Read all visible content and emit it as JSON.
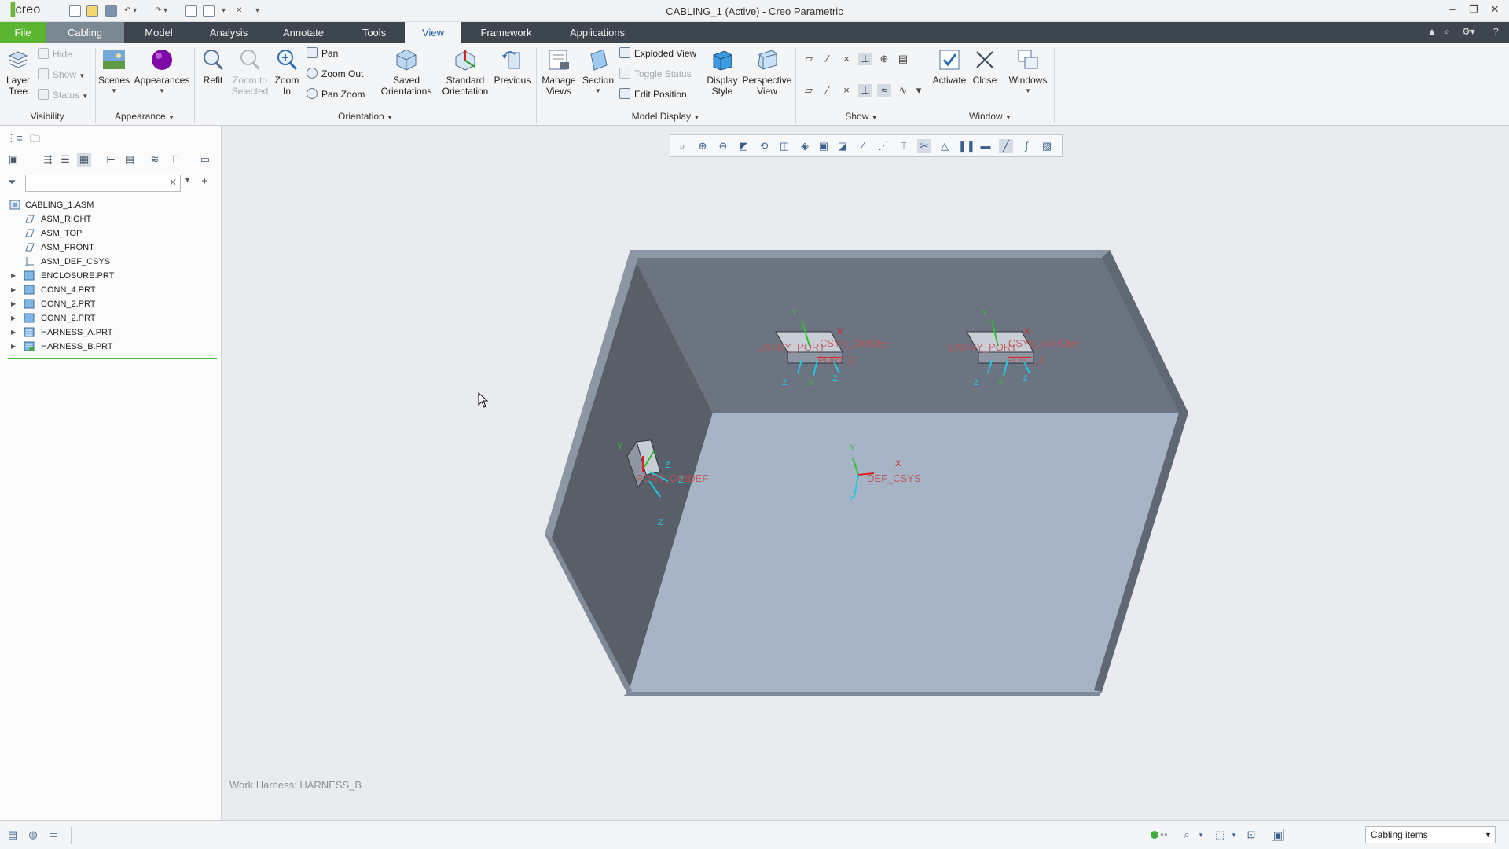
{
  "app": {
    "logo_text": "creo",
    "title": "CABLING_1 (Active) - Creo Parametric"
  },
  "menu": {
    "tabs": [
      "File",
      "Cabling",
      "Model",
      "Analysis",
      "Annotate",
      "Tools",
      "View",
      "Framework",
      "Applications"
    ],
    "active_tab": "View"
  },
  "ribbon": {
    "visibility": {
      "group_label": "Visibility",
      "layer_tree": "Layer\nTree",
      "hide": "Hide",
      "show": "Show",
      "status": "Status"
    },
    "appearance": {
      "group_label": "Appearance",
      "scenes": "Scenes",
      "appearances": "Appearances"
    },
    "orientation": {
      "group_label": "Orientation",
      "refit": "Refit",
      "zoom_to_selected": "Zoom to\nSelected",
      "zoom_in": "Zoom\nIn",
      "pan": "Pan",
      "zoom_out": "Zoom Out",
      "pan_zoom": "Pan Zoom",
      "saved_orientations": "Saved\nOrientations",
      "standard_orientation": "Standard\nOrientation",
      "previous": "Previous"
    },
    "model_display": {
      "group_label": "Model Display",
      "manage_views": "Manage\nViews",
      "section": "Section",
      "exploded_view": "Exploded View",
      "toggle_status": "Toggle Status",
      "edit_position": "Edit Position",
      "display_style": "Display\nStyle",
      "perspective_view": "Perspective\nView"
    },
    "show": {
      "group_label": "Show"
    },
    "window": {
      "group_label": "Window",
      "activate": "Activate",
      "close": "Close",
      "windows": "Windows"
    }
  },
  "model_tree": {
    "items": [
      {
        "label": "CABLING_1.ASM",
        "type": "assembly",
        "expandable": false
      },
      {
        "label": "ASM_RIGHT",
        "type": "datum-plane",
        "expandable": false
      },
      {
        "label": "ASM_TOP",
        "type": "datum-plane",
        "expandable": false
      },
      {
        "label": "ASM_FRONT",
        "type": "datum-plane",
        "expandable": false
      },
      {
        "label": "ASM_DEF_CSYS",
        "type": "csys",
        "expandable": false
      },
      {
        "label": "ENCLOSURE.PRT",
        "type": "part",
        "expandable": true
      },
      {
        "label": "CONN_4.PRT",
        "type": "part",
        "expandable": true
      },
      {
        "label": "CONN_2.PRT",
        "type": "part",
        "expandable": true
      },
      {
        "label": "CONN_2.PRT",
        "type": "part",
        "expandable": true
      },
      {
        "label": "HARNESS_A.PRT",
        "type": "harness",
        "expandable": true
      },
      {
        "label": "HARNESS_B.PRT",
        "type": "harness",
        "expandable": true
      }
    ]
  },
  "viewport": {
    "work_harness": "Work Harness: HARNESS_B",
    "colors": {
      "background": "#e9ebee",
      "floor": "#a6b4c6",
      "back_wall": "#6b7480",
      "side_wall": "#585f69",
      "rim": "#8c97a5",
      "csys_x": "#e02020",
      "csys_y": "#30c030",
      "csys_z": "#20c8e0"
    },
    "annotations": [
      {
        "text": "ENTRY_PORT",
        "color": "#c05050"
      },
      {
        "text": "CSYS_ORIDEF",
        "color": "#c05050"
      },
      {
        "text": "PORT_2",
        "color": "#c05050"
      },
      {
        "text": "ENTRY_PORT",
        "color": "#c05050"
      },
      {
        "text": "CSYS_ORIDEF",
        "color": "#c05050"
      },
      {
        "text": "PORT_2",
        "color": "#c05050"
      },
      {
        "text": "PORT_ORIDEF",
        "color": "#c05050"
      },
      {
        "text": "DEF_CSYS",
        "color": "#c05050"
      }
    ],
    "axis_letters": [
      "X",
      "Y",
      "Z"
    ]
  },
  "statusbar": {
    "filter_value": "Cabling items"
  }
}
